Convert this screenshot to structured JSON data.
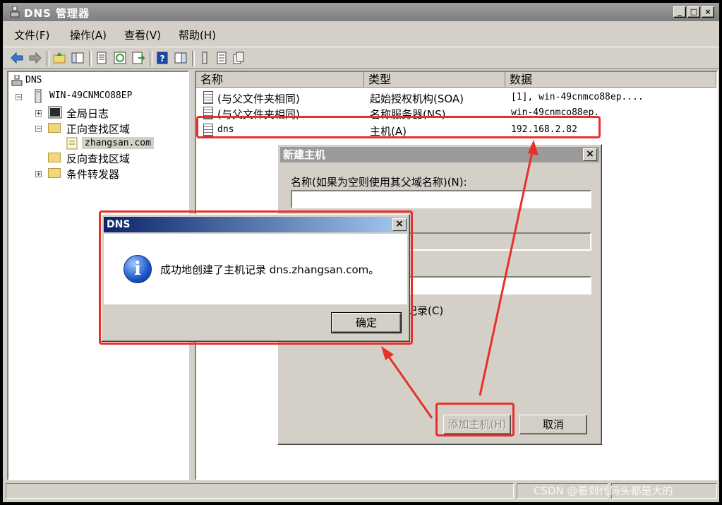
{
  "window": {
    "title": "DNS 管理器",
    "min_label": "_",
    "max_label": "□",
    "close_label": "×"
  },
  "menu": {
    "file": "文件(F)",
    "action": "操作(A)",
    "view": "查看(V)",
    "help": "帮助(H)"
  },
  "tree": {
    "root": "DNS",
    "server": "WIN-49CNMCO88EP",
    "global_logs": "全局日志",
    "forward_zones": "正向查找区域",
    "zone": "zhangsan.com",
    "reverse_zones": "反向查找区域",
    "conditional_forwarders": "条件转发器",
    "expand_plus": "+",
    "expand_minus": "−"
  },
  "list": {
    "columns": [
      "名称",
      "类型",
      "数据"
    ],
    "rows": [
      {
        "name": "(与父文件夹相同)",
        "type": "起始授权机构(SOA)",
        "data": "[1], win-49cnmco88ep...."
      },
      {
        "name": "(与父文件夹相同)",
        "type": "名称服务器(NS)",
        "data": "win-49cnmco88ep."
      },
      {
        "name": "dns",
        "type": "主机(A)",
        "data": "192.168.2.82"
      }
    ]
  },
  "new_host_dialog": {
    "title": "新建主机",
    "name_label": "名称(如果为空则使用其父域名称)(N):",
    "name_value": "",
    "ptr_label_fragment": "记录(C)",
    "add_button": "添加主机(H)",
    "cancel_button": "取消",
    "close_label": "×"
  },
  "message_box": {
    "title": "DNS",
    "message": "成功地创建了主机记录 dns.zhangsan.com。",
    "info_glyph": "i",
    "ok_button": "确定",
    "close_label": "×"
  },
  "watermark": "CSDN @看到代码头都是大的",
  "colors": {
    "highlight_red": "#e8302a",
    "active_title": "#0a246a",
    "inactive_title": "#9a9a9a"
  }
}
